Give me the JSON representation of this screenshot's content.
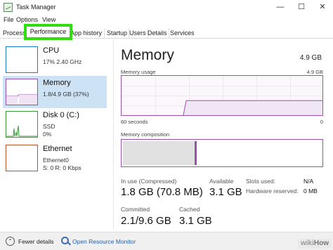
{
  "window": {
    "title": "Task Manager",
    "minimize": "—",
    "maximize": "☐",
    "close": "✕"
  },
  "menu": [
    "File",
    "Options",
    "View"
  ],
  "tabs": [
    "Processes",
    "Performance",
    "App history",
    "Startup",
    "Users",
    "Details",
    "Services"
  ],
  "sidebar": [
    {
      "name": "CPU",
      "sub1": "17%  2.40 GHz",
      "sub2": ""
    },
    {
      "name": "Memory",
      "sub1": "1.8/4.9 GB (37%)",
      "sub2": ""
    },
    {
      "name": "Disk 0 (C:)",
      "sub1": "SSD",
      "sub2": "0%"
    },
    {
      "name": "Ethernet",
      "sub1": "Ethernet0",
      "sub2": "S: 0 R: 0 Kbps"
    }
  ],
  "main": {
    "title": "Memory",
    "total": "4.9 GB",
    "usage_label": "Memory usage",
    "usage_max": "4.9 GB",
    "time_left": "60 seconds",
    "time_right": "0",
    "composition_label": "Memory composition",
    "usage_fraction": 0.37
  },
  "stats": {
    "in_use_label": "In use (Compressed)",
    "in_use_value": "1.8 GB (70.8 MB)",
    "available_label": "Available",
    "available_value": "3.1 GB",
    "committed_label": "Committed",
    "committed_value": "2.1/9.6 GB",
    "cached_label": "Cached",
    "cached_value": "3.1 GB",
    "slots_label": "Slots used:",
    "slots_value": "N/A",
    "hw_reserved_label": "Hardware reserved:",
    "hw_reserved_value": "0 MB"
  },
  "footer": {
    "fewer_details": "Fewer details",
    "open_monitor": "Open Resource Monitor"
  },
  "watermark": {
    "prefix": "wiki",
    "suffix": "How"
  },
  "colors": {
    "memory_accent": "#9b4fb0",
    "cpu_accent": "#1a7dc4",
    "disk_accent": "#3a9a3a",
    "ethernet_accent": "#b5552a",
    "highlight": "#33dd11",
    "selected_bg": "#cde3f5"
  }
}
